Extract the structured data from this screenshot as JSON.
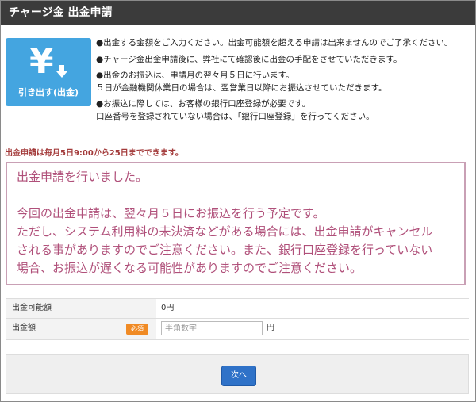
{
  "title": "チャージ金 出金申請",
  "logo": {
    "symbol": "¥",
    "label": "引き出す(出金)",
    "icon": "yen-withdraw-icon"
  },
  "notes": [
    "●出金する金額をご入力ください。出金可能額を超える申請は出来ませんのでご了承ください。",
    "●チャージ金出金申請後に、弊社にて確認後に出金の手配をさせていただきます。",
    "●出金のお振込は、申請月の翌々月５日に行います。",
    "５日が金融機関休業日の場合は、翌営業日以降にお振込させていただきます。",
    "●お振込に際しては、お客様の銀行口座登録が必要です。",
    "口座番号を登録されていない場合は、「銀行口座登録」を行ってください。"
  ],
  "schedule_note": "出金申請は毎月5日9:00から25日までできます。",
  "message": {
    "line1": "出金申請を行いました。",
    "line2": "今回の出金申請は、翌々月５日にお振込を行う予定です。",
    "line3": "ただし、システム利用料の未決済などがある場合には、出金申請がキャンセル",
    "line4": "される事がありますのでご注意ください。また、銀行口座登録を行っていない",
    "line5": "場合、お振込が遅くなる可能性がありますのでご注意ください。"
  },
  "form": {
    "available_label": "出金可能額",
    "available_value": "0円",
    "amount_label": "出金額",
    "required_badge": "必須",
    "amount_placeholder": "半角数字",
    "amount_value": "",
    "unit": "円"
  },
  "next_button": "次へ",
  "colors": {
    "titlebar": "#3b3b3b",
    "logo": "#44a5e0",
    "message_text": "#b0507a",
    "message_border": "#c9a0b5",
    "schedule_text": "#a33a3a",
    "badge": "#f08a24",
    "button": "#2f72c8"
  }
}
